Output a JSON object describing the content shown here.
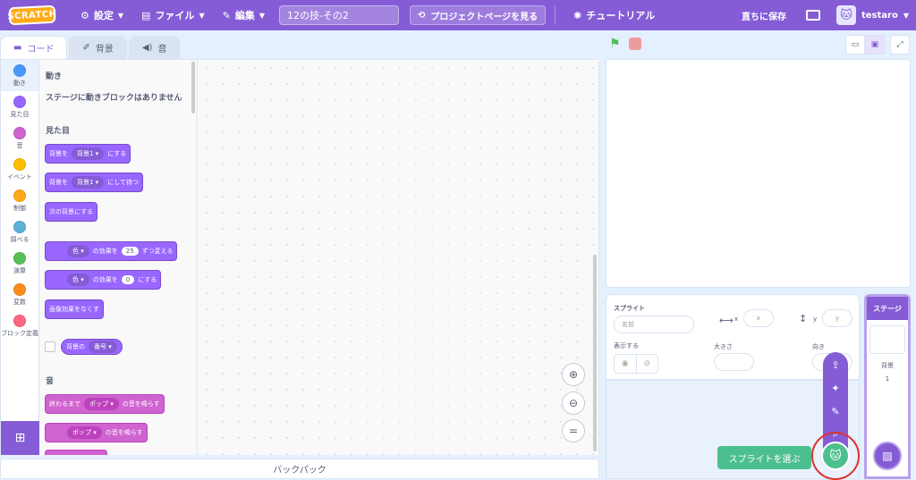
{
  "menubar": {
    "logo": "SCRATCH",
    "settings": "設定",
    "file": "ファイル",
    "edit": "編集",
    "project_title": "12の技-その2",
    "project_page": "プロジェクトページを見る",
    "tutorial": "チュートリアル",
    "save_now": "直ちに保存",
    "username": "testaro"
  },
  "tabs": {
    "code": "コード",
    "costumes": "背景",
    "sounds": "音"
  },
  "categories": [
    {
      "label": "動き",
      "color": "#4c97ff"
    },
    {
      "label": "見た目",
      "color": "#9966ff"
    },
    {
      "label": "音",
      "color": "#cf63cf"
    },
    {
      "label": "イベント",
      "color": "#ffbf00"
    },
    {
      "label": "制御",
      "color": "#ffab19"
    },
    {
      "label": "調べる",
      "color": "#5cb1d6"
    },
    {
      "label": "演算",
      "color": "#59c059"
    },
    {
      "label": "変数",
      "color": "#ff8c1a"
    },
    {
      "label": "ブロック定義",
      "color": "#ff6680"
    }
  ],
  "palette": {
    "motion_head": "動き",
    "motion_note": "ステージに動きブロックはありません",
    "looks_head": "見た目",
    "sound_head": "音",
    "blocks": {
      "b1_pre": "背景を",
      "b1_chip": "背景1 ▾",
      "b1_post": "にする",
      "b2_pre": "背景を",
      "b2_chip": "背景1 ▾",
      "b2_post": "にして待つ",
      "b3": "次の背景にする",
      "b4_chip": "色 ▾",
      "b4_mid": "の効果を",
      "b4_num": "25",
      "b4_post": "ずつ変える",
      "b5_chip": "色 ▾",
      "b5_mid": "の効果を",
      "b5_num": "0",
      "b5_post": "にする",
      "b6": "画像効果をなくす",
      "r1_pre": "背景の",
      "r1_chip": "番号 ▾",
      "s1_pre": "終わるまで",
      "s1_chip": "ポップ ▾",
      "s1_post": "の音を鳴らす",
      "s2_chip": "ポップ ▾",
      "s2_post": "の音を鳴らす"
    }
  },
  "backpack": "バックパック",
  "sprite_info": {
    "sprite_label": "スプライト",
    "name_placeholder": "名前",
    "x_label": "x",
    "x_placeholder": "x",
    "y_label": "y",
    "y_placeholder": "y",
    "show_label": "表示する",
    "size_label": "大きさ",
    "direction_label": "向き"
  },
  "tooltip": "スプライトを選ぶ",
  "stage_panel": {
    "title": "ステージ",
    "backdrop_label": "背景",
    "backdrop_count": "1"
  }
}
